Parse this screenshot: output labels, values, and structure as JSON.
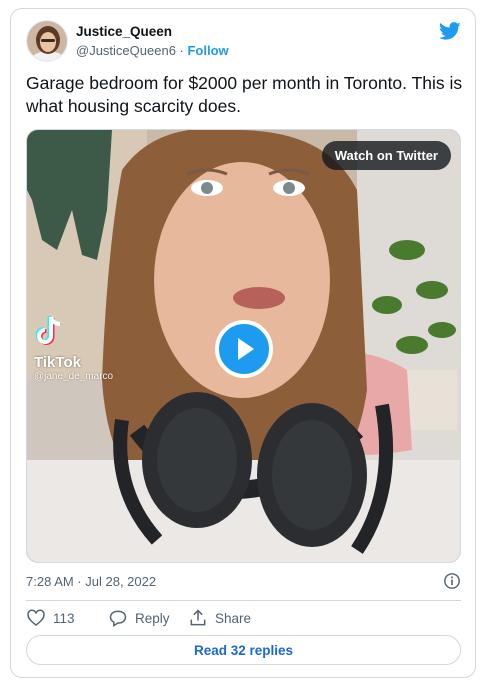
{
  "tweet": {
    "author": {
      "display_name": "Justice_Queen",
      "handle": "@JusticeQueen6",
      "separator": " · ",
      "follow_label": "Follow",
      "avatar_icon": "profile-photo"
    },
    "brand_icon": "twitter-bird-icon",
    "text": "Garage bedroom for $2000 per month in Toronto. This is what housing scarcity does.",
    "media": {
      "watch_label": "Watch on Twitter",
      "watermark_brand": "TikTok",
      "watermark_user": "@jane_de_marco",
      "play_icon": "play-icon"
    },
    "timestamp": "7:28 AM · Jul 28, 2022",
    "actions": {
      "like_count": "113",
      "reply_label": "Reply",
      "share_label": "Share"
    },
    "read_replies_label": "Read 32 replies"
  },
  "colors": {
    "accent": "#1d9bf0",
    "link": "#1d67d6",
    "muted": "#536471",
    "border": "#cfd9de"
  }
}
